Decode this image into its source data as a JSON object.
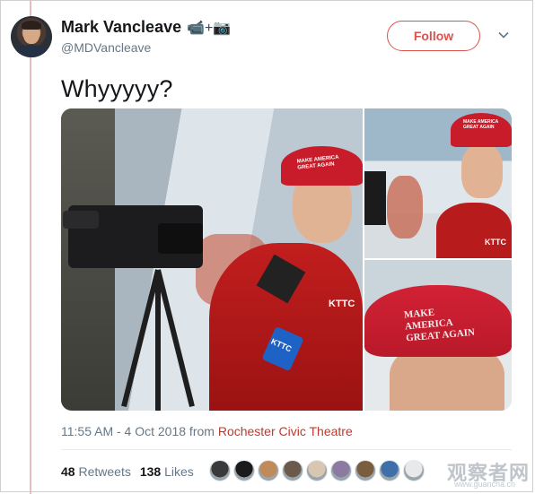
{
  "tweet": {
    "author_name": "Mark Vancleave",
    "author_emoji": "📹+📷",
    "handle": "@MDVancleave",
    "follow_label": "Follow",
    "text": "Whyyyyy?",
    "timestamp": "11:55 AM - 4 Oct 2018 from",
    "location": "Rochester Civic Theatre",
    "retweets_count": "48",
    "retweets_label": "Retweets",
    "likes_count": "138",
    "likes_label": "Likes"
  },
  "photos": {
    "main_cap_text": "MAKE AMERICA GREAT AGAIN",
    "main_jacket_logo": "KTTC",
    "mic_flag": "KTTC",
    "top_cap_text": "MAKE AMERICA GREAT AGAIN",
    "top_jacket_logo": "KTTC",
    "bottom_cap_text": "MAKE AMERICA GREAT AGAIN"
  },
  "likers": {
    "colors": [
      "#3a3a3a",
      "#1b1b1b",
      "#c08a5a",
      "#6b5a4c",
      "#d8c6b0",
      "#8d7aa0",
      "#7a5c3e",
      "#3f6fa8",
      "#e9e9ea"
    ]
  },
  "watermark": {
    "main": "观察者网",
    "sub": "www.guancha.cn"
  },
  "icons": {
    "chevron": "chevron-down-icon",
    "video_camera": "video-camera-icon",
    "camera": "camera-icon"
  }
}
